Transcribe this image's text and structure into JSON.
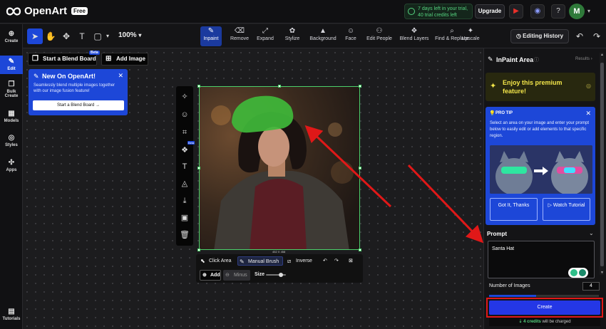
{
  "app": {
    "brand": "OpenArt",
    "plan_badge": "Free"
  },
  "header": {
    "trial_line1": "7 days left in your trial,",
    "trial_line2": "40 trial credits left",
    "upgrade": "Upgrade",
    "avatar_letter": "M"
  },
  "sidebar": {
    "items": [
      {
        "label": "Create",
        "icon": "plus-icon"
      },
      {
        "label": "Edit",
        "icon": "edit-icon"
      },
      {
        "label": "Bulk Create",
        "icon": "layers-icon"
      },
      {
        "label": "Models",
        "icon": "grid-icon"
      },
      {
        "label": "Styles",
        "icon": "palette-icon"
      },
      {
        "label": "Apps",
        "icon": "apps-icon"
      },
      {
        "label": "Tutorials",
        "icon": "book-icon"
      }
    ]
  },
  "toolbar": {
    "zoom": "100%",
    "tools": [
      {
        "label": "Inpaint",
        "active": true
      },
      {
        "label": "Remove"
      },
      {
        "label": "Expand"
      },
      {
        "label": "Stylize"
      },
      {
        "label": "Background"
      },
      {
        "label": "Face"
      },
      {
        "label": "Edit People"
      },
      {
        "label": "Blend Layers"
      },
      {
        "label": "Find & Replace"
      },
      {
        "label": "Upscale"
      }
    ],
    "history": "Editing History"
  },
  "canvas": {
    "blend_board": "Start a Blend Board",
    "beta": "Beta",
    "add_image": "Add Image",
    "new_card": {
      "title": "New On OpenArt!",
      "desc": "Seamlessly blend multiple images together with our image fusion feature!",
      "button": "Start a Blend Board"
    },
    "image_dims": "452 X 458",
    "bottom_tools": {
      "click_area": "Click Area",
      "manual_brush": "Manual Brush",
      "inverse": "Inverse",
      "add": "Add",
      "minus": "Minus",
      "size": "Size",
      "size_level": 0.75
    }
  },
  "panel": {
    "title": "InPaint Area",
    "results": "Results",
    "premium": "Enjoy this premium feature!",
    "protip": {
      "heading": "PRO TIP",
      "desc": "Select an area on your image and enter your prompt below to easily edit or add elements to that specific region.",
      "got_it": "Got It, Thanks",
      "watch": "Watch Tutorial"
    },
    "prompt_label": "Prompt",
    "prompt_value": "Santa Hat",
    "num_images_label": "Number of Images",
    "num_images": "4",
    "create": "Create",
    "credits": "4 credits",
    "charged": " will be charged"
  },
  "colors": {
    "accent": "#1d47d8",
    "brush": "#3fb83a",
    "highlight": "#e01818"
  }
}
